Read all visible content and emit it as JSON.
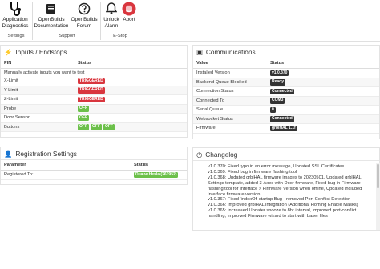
{
  "ribbon": {
    "buttons": [
      {
        "label": "Application\nDiagnostics",
        "icon": "stethoscope-icon"
      },
      {
        "label": "OpenBuilds\nDocumentation",
        "icon": "book-icon"
      },
      {
        "label": "OpenBuilds\nForum",
        "icon": "forum-icon"
      },
      {
        "label": "Unlock\nAlarm",
        "icon": "bell-icon"
      },
      {
        "label": "Abort",
        "icon": "stop-hand-icon"
      }
    ],
    "groups": [
      "Settings",
      "Support",
      "E-Stop"
    ]
  },
  "inputs_panel": {
    "title": "Inputs / Endstops",
    "col_pin": "PIN",
    "col_status": "Status",
    "note": "Manually activate inputs you want to test",
    "rows": [
      {
        "pin": "X-Limit",
        "badges": [
          "TRIGGERED"
        ]
      },
      {
        "pin": "Y-Limit",
        "badges": [
          "TRIGGERED"
        ]
      },
      {
        "pin": "Z-Limit",
        "badges": [
          "TRIGGERED"
        ]
      },
      {
        "pin": "Probe",
        "badges": [
          "OFF"
        ]
      },
      {
        "pin": "Door Sensor",
        "badges": [
          "OFF"
        ]
      },
      {
        "pin": "Buttons",
        "badges": [
          "OFF",
          "OFF",
          "OFF"
        ]
      }
    ]
  },
  "registration_panel": {
    "title": "Registration Settings",
    "col_param": "Parameter",
    "col_status": "Status",
    "rows": [
      {
        "param": "Registered To:",
        "status": "Duane Hesla (261952)"
      }
    ]
  },
  "comms_panel": {
    "title": "Communications",
    "col_value": "Value",
    "col_status": "Status",
    "rows": [
      {
        "value": "Installed Version",
        "status": "v1.0.370"
      },
      {
        "value": "Backend Queue Blocked",
        "status": "Ready"
      },
      {
        "value": "Connection Status",
        "status": "Connected"
      },
      {
        "value": "Connected To",
        "status": "COM3"
      },
      {
        "value": "Serial Queue",
        "status": "0"
      },
      {
        "value": "Websocket Status",
        "status": "Connected"
      },
      {
        "value": "Firmware",
        "status": "grblHAL 1.1f"
      }
    ]
  },
  "changelog_panel": {
    "title": "Changelog",
    "items": [
      "v1.0.370: Fixed typo in an error message, Updated SSL Certificates",
      "v1.0.369: Fixed bug in firmware flashing tool",
      "v1.0.368: Updated grblHAL firmware images to 20230501, Updated grblHAL Settings template, added 3-Axes with Door firmware, Fixed bug in Firmware flashing tool for Interface > Firmware Version when offline, Updated included Interface firmware version",
      "v1.0.367: Fixed 'indexOf' startup Bug - removed Port Conflict Detection",
      "v1.0.366: Improved grblHAL integration (Additional Homing Enable Masks)",
      "v1.0.365: Increased Updater snooze to 8hr interval, improved port-conflict handling, Improved Firmware wizard to start with Laser files"
    ]
  },
  "colors": {
    "triggered": "#d9363e",
    "off": "#6cc04a",
    "status": "#333333",
    "abort": "#d9363e"
  }
}
